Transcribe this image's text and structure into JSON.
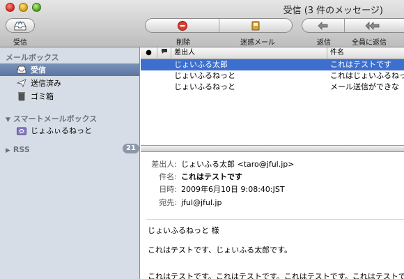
{
  "window": {
    "title": "受信 (3 件のメッセージ)"
  },
  "toolbar": {
    "inbox_label": "受信",
    "delete_label": "削除",
    "junk_label": "迷惑メール",
    "reply_label": "返信",
    "reply_all_label": "全員に返信"
  },
  "sidebar": {
    "mailboxes_header": "メールボックス",
    "items": [
      {
        "label": "受信",
        "icon": "inbox-icon"
      },
      {
        "label": "送信済み",
        "icon": "sent-icon"
      },
      {
        "label": "ゴミ箱",
        "icon": "trash-icon"
      }
    ],
    "smart_header": "スマートメールボックス",
    "smart_items": [
      {
        "label": "じょふぃるねっと",
        "icon": "smart-mailbox-icon"
      }
    ],
    "rss_label": "RSS",
    "rss_count": "21"
  },
  "list": {
    "columns": {
      "from": "差出人",
      "subject": "件名"
    },
    "rows": [
      {
        "from": "じょいふる太郎",
        "subject": "これはテストです",
        "selected": true
      },
      {
        "from": "じょいふるねっと",
        "subject": "これはじょいふるねっとご",
        "selected": false
      },
      {
        "from": "じょいふるねっと",
        "subject": "メール送信ができな",
        "selected": false
      }
    ]
  },
  "preview": {
    "headers": [
      {
        "key": "差出人:",
        "value": "じょいふる太郎 <taro@jful.jp>"
      },
      {
        "key": "件名:",
        "value": "これはテストです"
      },
      {
        "key": "日時:",
        "value": "2009年6月10日 9:08:40:JST"
      },
      {
        "key": "宛先:",
        "value": "jful@jful.jp"
      }
    ],
    "body": [
      "じょいふるねっと 様",
      "これはテストです、じょいふる太郎です。",
      "これはテストです。これはテストです。これはテストです。これはテストです。"
    ]
  },
  "colors": {
    "selection": "#3d6fce",
    "sidebar_bg": "#d7dde6",
    "sidebar_sel": "#5a76a3"
  }
}
